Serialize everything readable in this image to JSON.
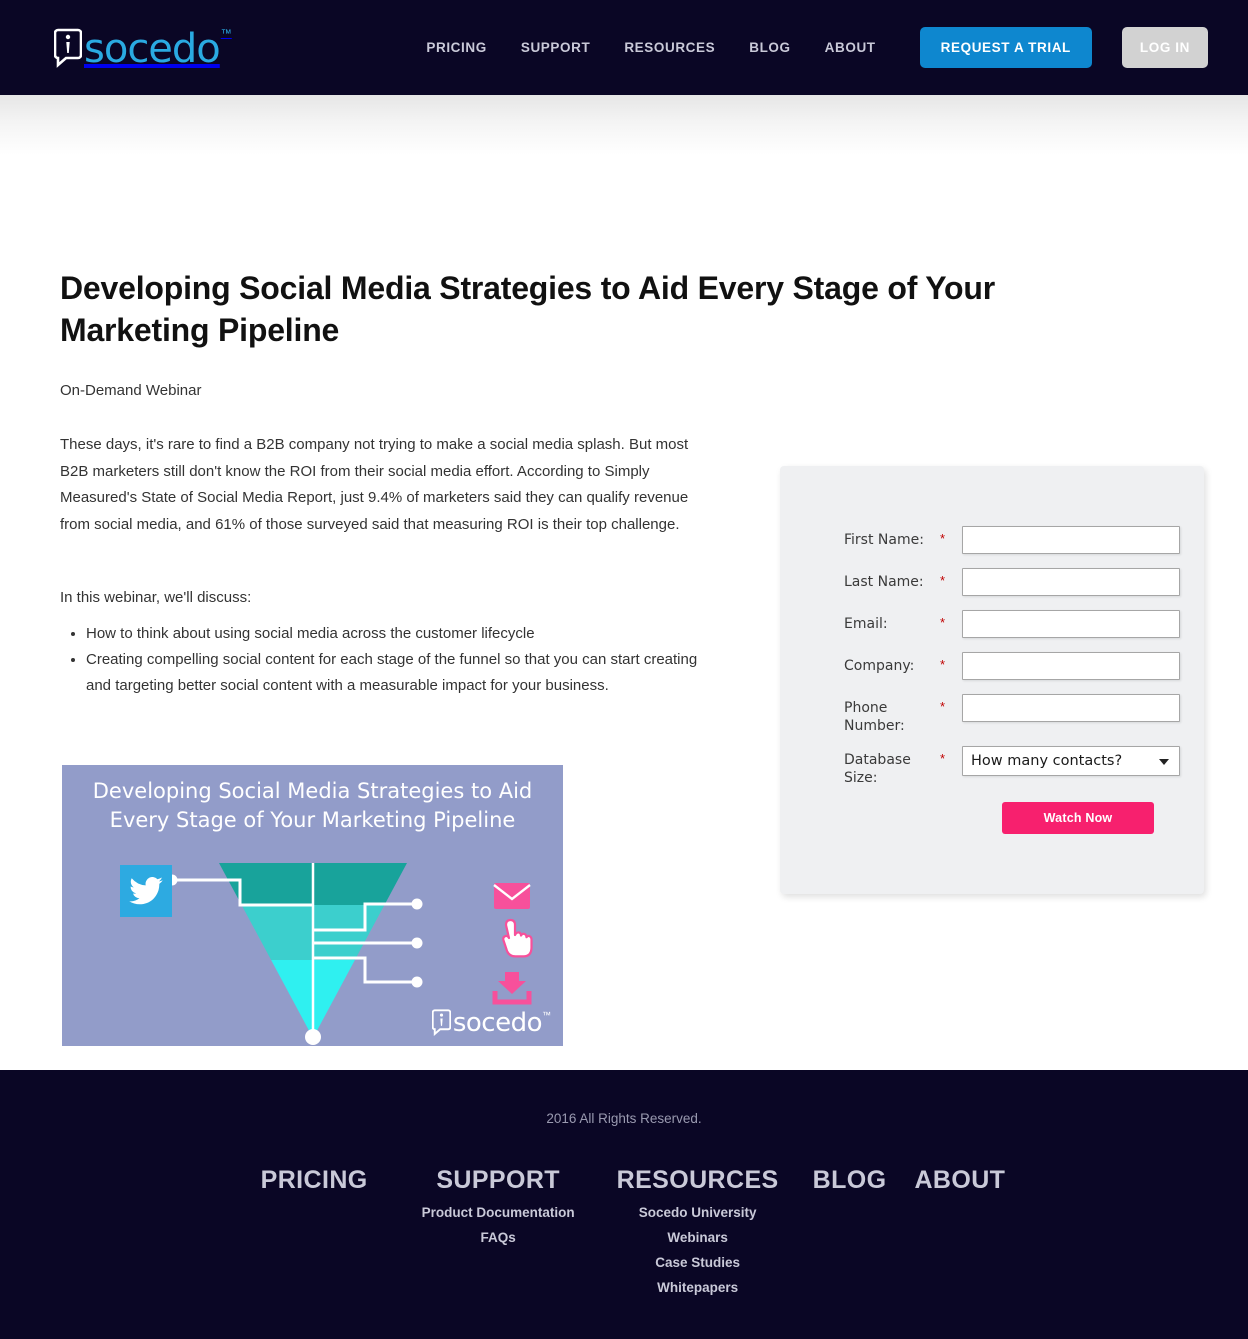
{
  "header": {
    "logo": {
      "word": "socedo",
      "tm": "™",
      "icon": "socedo-bubble-icon"
    },
    "nav": [
      {
        "label": "PRICING",
        "name": "nav-pricing"
      },
      {
        "label": "SUPPORT",
        "name": "nav-support"
      },
      {
        "label": "RESOURCES",
        "name": "nav-resources"
      },
      {
        "label": "BLOG",
        "name": "nav-blog"
      },
      {
        "label": "ABOUT",
        "name": "nav-about"
      }
    ],
    "trial_button": "REQUEST A TRIAL",
    "login_button": "LOG IN",
    "colors": {
      "bar": "#0a0625",
      "accent_blue": "#0e87cf",
      "login_gray": "#d2d2d2",
      "logo_blue": "#2aaae2"
    }
  },
  "main": {
    "title": "Developing Social Media Strategies to Aid Every Stage of Your Marketing Pipeline",
    "subtitle": "On-Demand Webinar",
    "paragraph": "These days, it's rare to find a B2B company not trying to make a social media splash. But most B2B marketers still don't know the ROI from their social media effort. According to Simply Measured's State of Social Media Report, just 9.4% of marketers said they can qualify revenue from social media, and 61% of those surveyed said that measuring ROI is their top challenge.",
    "lead_in": "In this webinar, we'll discuss:",
    "bullets": [
      "How to think about using social media across the customer lifecycle",
      "Creating compelling social content for each stage of the funnel so that you can start creating and targeting better social content with a measurable impact for your business."
    ]
  },
  "thumbnail": {
    "title": "Developing Social Media Strategies to Aid Every Stage of Your Marketing Pipeline",
    "logo_word": "socedo",
    "logo_tm": "™",
    "icons": [
      "twitter-bird-icon",
      "envelope-icon",
      "hand-cursor-icon",
      "download-icon"
    ],
    "colors": {
      "background": "#929cc9",
      "twitter_blue": "#2daae1",
      "funnel_top": "#18a39b",
      "funnel_mid": "#3fd2cf",
      "funnel_bottom": "#2ff0f0",
      "pink": "#f7509b"
    }
  },
  "form": {
    "fields": [
      {
        "label": "First Name:",
        "required": "*",
        "value": "",
        "placeholder": "",
        "name": "first-name-field"
      },
      {
        "label": "Last Name:",
        "required": "*",
        "value": "",
        "placeholder": "",
        "name": "last-name-field"
      },
      {
        "label": "Email:",
        "required": "*",
        "value": "",
        "placeholder": "",
        "name": "email-field"
      },
      {
        "label": "Company:",
        "required": "*",
        "value": "",
        "placeholder": "",
        "name": "company-field"
      },
      {
        "label": "Phone Number:",
        "required": "*",
        "value": "",
        "placeholder": "",
        "name": "phone-number-field"
      }
    ],
    "select": {
      "label": "Database Size:",
      "required": "*",
      "selected": "How many contacts?",
      "name": "database-size-select"
    },
    "submit_button": "Watch Now",
    "colors": {
      "panel": "#eff0f2",
      "submit_pink": "#f7206e",
      "required_red": "#c00000"
    }
  },
  "footer": {
    "copyright": "2016 All Rights Reserved.",
    "columns": [
      {
        "head": "PRICING",
        "links": []
      },
      {
        "head": "SUPPORT",
        "links": [
          "Product Documentation",
          "FAQs"
        ]
      },
      {
        "head": "RESOURCES",
        "links": [
          "Socedo University",
          "Webinars",
          "Case Studies",
          "Whitepapers"
        ]
      },
      {
        "head": "BLOG",
        "links": []
      },
      {
        "head": "ABOUT",
        "links": []
      }
    ],
    "colors": {
      "background": "#0a0625",
      "text": "#c9c9d8"
    }
  }
}
